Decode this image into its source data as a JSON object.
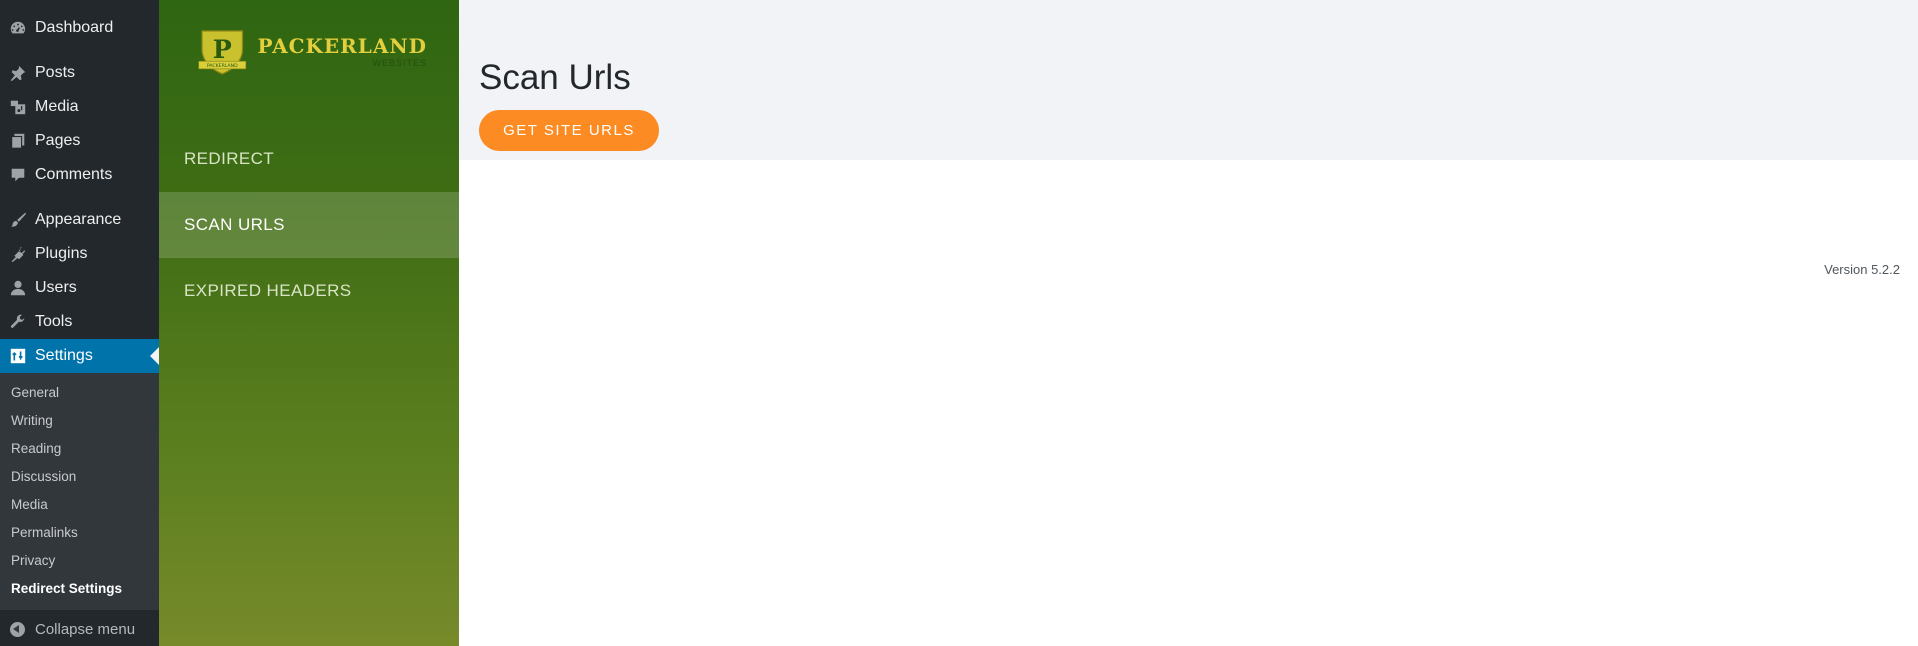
{
  "admin_menu": {
    "items": [
      {
        "label": "Dashboard",
        "icon": "dashboard-icon"
      },
      {
        "label": "Posts",
        "icon": "pin-icon"
      },
      {
        "label": "Media",
        "icon": "media-icon"
      },
      {
        "label": "Pages",
        "icon": "pages-icon"
      },
      {
        "label": "Comments",
        "icon": "comment-icon"
      },
      {
        "label": "Appearance",
        "icon": "paintbrush-icon"
      },
      {
        "label": "Plugins",
        "icon": "plug-icon"
      },
      {
        "label": "Users",
        "icon": "user-icon"
      },
      {
        "label": "Tools",
        "icon": "wrench-icon"
      },
      {
        "label": "Settings",
        "icon": "settings-icon"
      }
    ],
    "current": "Settings",
    "submenu": [
      "General",
      "Writing",
      "Reading",
      "Discussion",
      "Media",
      "Permalinks",
      "Privacy",
      "Redirect Settings"
    ],
    "current_submenu": "Redirect Settings",
    "collapse_label": "Collapse menu"
  },
  "plugin": {
    "logo": {
      "letter": "P",
      "title": "PACKERLAND",
      "subtitle": "WEBSITES",
      "badge": "PACKERLAND"
    },
    "nav": [
      {
        "label": "REDIRECT"
      },
      {
        "label": "SCAN URLS"
      },
      {
        "label": "EXPIRED HEADERS"
      }
    ],
    "active_nav": "SCAN URLS"
  },
  "main": {
    "title": "Scan Urls",
    "button_label": "GET SITE URLS",
    "version": "Version 5.2.2"
  },
  "colors": {
    "wp_sidebar": "#23282d",
    "wp_accent": "#0073aa",
    "plugin_green": "#2f6612",
    "button_orange": "#fd8b23"
  }
}
